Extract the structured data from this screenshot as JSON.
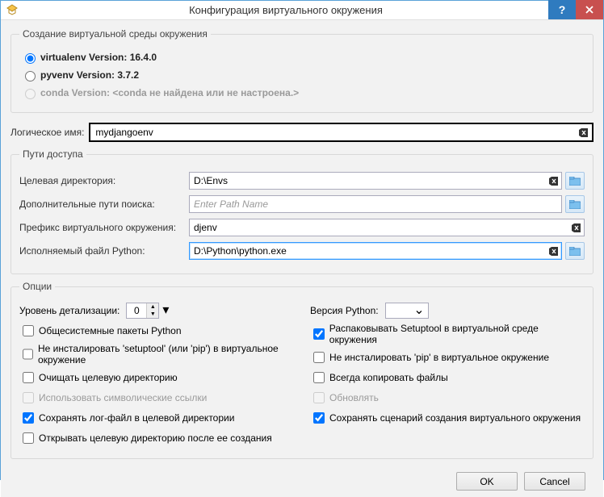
{
  "window": {
    "title": "Конфигурация виртуального окружения"
  },
  "creation": {
    "legend": "Создание виртуальной среды окружения",
    "virtualenv": "virtualenv Version: 16.4.0",
    "pyvenv": "pyvenv Version: 3.7.2",
    "conda": "conda Version: <conda не найдена или не настроена.>"
  },
  "name": {
    "label": "Логическое имя:",
    "value": "mydjangoenv"
  },
  "paths": {
    "legend": "Пути доступа",
    "target": {
      "label": "Целевая директория:",
      "value": "D:\\Envs"
    },
    "extra": {
      "label": "Дополнительные пути поиска:",
      "placeholder": "Enter Path Name",
      "value": ""
    },
    "prefix": {
      "label": "Префикс виртуального окружения:",
      "value": "djenv"
    },
    "python": {
      "label": "Исполняемый файл Python:",
      "value": "D:\\Python\\python.exe"
    }
  },
  "options": {
    "legend": "Опции",
    "left": {
      "verbosity_label": "Уровень детализации:",
      "verbosity_value": "0",
      "system_packages": "Общесистемные пакеты Python",
      "no_setuptool": "Не инсталировать 'setuptool' (или 'pip') в виртуальное окружение",
      "clear_target": "Очищать целевую директорию",
      "symlinks": "Использовать символические ссылки",
      "save_log": "Сохранять лог-файл в целевой директории",
      "open_target": "Открывать целевую директорию после ее создания"
    },
    "right": {
      "python_version_label": "Версия Python:",
      "unpack_setuptool": "Распаковывать Setuptool в виртуальной среде окружения",
      "no_pip": "Не инсталировать 'pip' в виртуальное окружение",
      "always_copy": "Всегда копировать файлы",
      "update": "Обновлять",
      "save_scripts": "Сохранять сценарий создания виртуального окружения"
    }
  },
  "footer": {
    "ok": "OK",
    "cancel": "Cancel"
  }
}
